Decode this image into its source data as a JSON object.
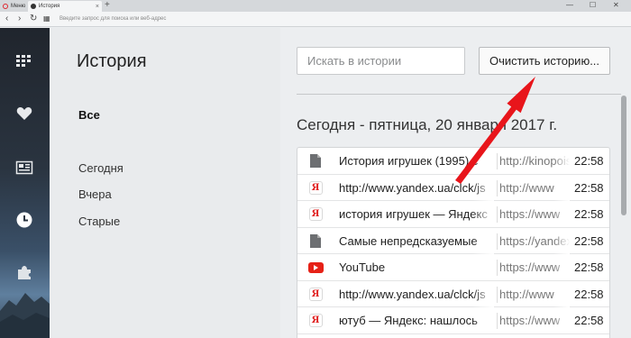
{
  "tabs": [
    {
      "label": "Меню",
      "icon": "opera-icon"
    },
    {
      "label": "История",
      "icon": "clock-icon"
    }
  ],
  "address_bar": {
    "placeholder": "Введите запрос для поиска или веб-адрес"
  },
  "nav": {
    "title": "История",
    "items": [
      "Все",
      "Сегодня",
      "Вчера",
      "Старые"
    ]
  },
  "main": {
    "search_placeholder": "Искать в истории",
    "clear_button": "Очистить историю...",
    "date_heading": "Сегодня - пятница, 20 января 2017 г."
  },
  "history": [
    {
      "icon": "page-icon",
      "title": "История игрушек (1995) с",
      "url": "http://kinopoisk",
      "time": "22:58"
    },
    {
      "icon": "yandex-icon",
      "title": "http://www.yandex.ua/clck/js",
      "url": "http://www",
      "time": "22:58"
    },
    {
      "icon": "yandex-icon",
      "title": "история игрушек — Яндекс",
      "url": "https://www",
      "time": "22:58"
    },
    {
      "icon": "page-icon",
      "title": "Самые непредсказуемые",
      "url": "https://yandex",
      "time": "22:58"
    },
    {
      "icon": "youtube-icon",
      "title": "YouTube",
      "url": "https://www",
      "time": "22:58"
    },
    {
      "icon": "yandex-icon",
      "title": "http://www.yandex.ua/clck/js",
      "url": "http://www",
      "time": "22:58"
    },
    {
      "icon": "yandex-icon",
      "title": "ютуб — Яндекс: нашлось",
      "url": "https://www",
      "time": "22:58"
    }
  ],
  "colors": {
    "arrow": "#e8151b",
    "sidebar_dark": "#20252d",
    "yandex_red": "#e02020",
    "youtube_red": "#e62117"
  }
}
